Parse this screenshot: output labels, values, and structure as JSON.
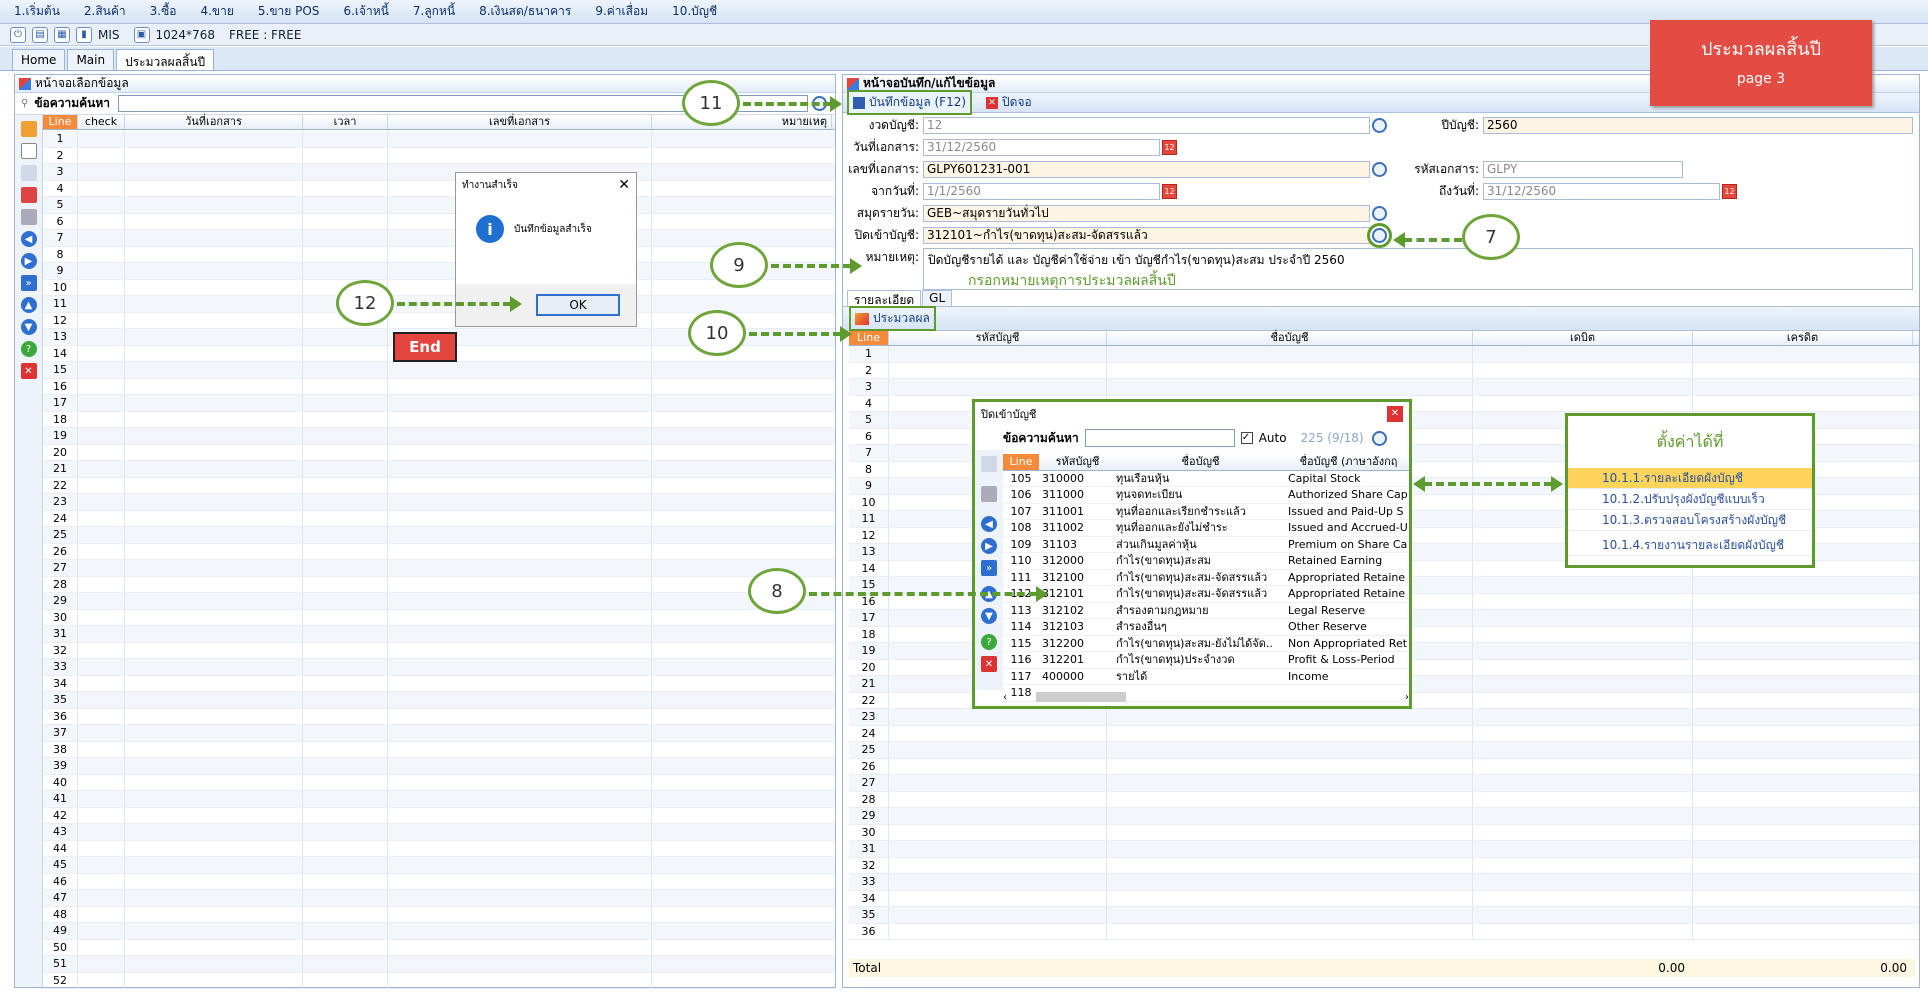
{
  "menu": [
    "1.เริ่มต้น",
    "2.สินค้า",
    "3.ซื้อ",
    "4.ขาย",
    "5.ขาย POS",
    "6.เจ้าหนี้",
    "7.ลูกหนี้",
    "8.เงินสด/ธนาคาร",
    "9.ค่าเสื่อม",
    "10.บัญชี"
  ],
  "toolbar": {
    "mis": "MIS",
    "resolution": "1024*768",
    "free": "FREE : FREE"
  },
  "tabs": [
    "Home",
    "Main",
    "ประมวลผลสิ้นปี"
  ],
  "left_panel": {
    "title": "หน้าจอเลือกข้อมูล",
    "search_label": "ข้อความค้นหา",
    "columns": [
      "Line",
      "check",
      "วันที่เอกสาร",
      "เวลา",
      "เลขที่เอกสาร",
      "หมายเหตุ"
    ],
    "rows": [
      1,
      2,
      3,
      4,
      5,
      6,
      7,
      8,
      9,
      10,
      11,
      12,
      13,
      14,
      15,
      16,
      17,
      18,
      19,
      20,
      21,
      22,
      23,
      24,
      25,
      26,
      27,
      28,
      29,
      30,
      31,
      32,
      33,
      34,
      35,
      36,
      37,
      38,
      39,
      40,
      41,
      42,
      43,
      44,
      45,
      46,
      47,
      48,
      49,
      50,
      51,
      52
    ]
  },
  "right_panel": {
    "title": "หน้าจอบันทึก/แก้ไขข้อมูล",
    "save_btn": "บันทึกข้อมูล (F12)",
    "close_btn": "ปิดจอ",
    "fields": {
      "period_label": "งวดบัญชี:",
      "period_value": "12",
      "year_label": "ปีบัญชี:",
      "year_value": "2560",
      "docdate_label": "วันที่เอกสาร:",
      "docdate_value": "31/12/2560",
      "docno_label": "เลขที่เอกสาร:",
      "docno_value": "GLPY601231-001",
      "doccode_label": "รหัสเอกสาร:",
      "doccode_value": "GLPY",
      "from_label": "จากวันที่:",
      "from_value": "1/1/2560",
      "to_label": "ถึงวันที่:",
      "to_value": "31/12/2560",
      "journal_label": "สมุดรายวัน:",
      "journal_value": "GEB~สมุดรายวันทั่วไป",
      "closeacct_label": "ปิดเข้าบัญชี:",
      "closeacct_value": "312101~กำไร(ขาดทุน)สะสม-จัดสรรแล้ว",
      "remark_label": "หมายเหตุ:",
      "remark_value": "ปิดบัญชีรายได้ และ บัญชีค่าใช้จ่าย เข้า บัญชีกำไร(ขาดทุน)สะสม ประจำปี 2560",
      "remark_hint": "กรอกหมายเหตุการประมวลผลสิ้นปี"
    },
    "subtabs": [
      "รายละเอียด",
      "GL"
    ],
    "process_btn": "ประมวลผล",
    "columns": [
      "Line",
      "รหัสบัญชี",
      "ชื่อบัญชี",
      "เดบิต",
      "เครดิต"
    ],
    "rows": [
      1,
      2,
      3,
      4,
      5,
      6,
      7,
      8,
      9,
      10,
      11,
      12,
      13,
      14,
      15,
      16,
      17,
      18,
      19,
      20,
      21,
      22,
      23,
      24,
      25,
      26,
      27,
      28,
      29,
      30,
      31,
      32,
      33,
      34,
      35,
      36
    ],
    "total_label": "Total",
    "total_debit": "0.00",
    "total_credit": "0.00"
  },
  "banner": {
    "title": "ประมวลผลสิ้นปี",
    "page": "page 3"
  },
  "dialog": {
    "title": "ทำงานสำเร็จ",
    "message": "บันทึกข้อมูลสำเร็จ",
    "ok": "OK"
  },
  "end_label": "End",
  "popup": {
    "title": "ปิดเข้าบัญชี",
    "search_label": "ข้อความค้นหา",
    "auto_label": "Auto",
    "count": "225 (9/18)",
    "columns": [
      "Line",
      "รหัสบัญชี",
      "ชื่อบัญชี",
      "ชื่อบัญชี (ภาษาอังกฤ"
    ],
    "rows": [
      [
        "105",
        "310000",
        "ทุนเรือนหุ้น",
        "Capital Stock"
      ],
      [
        "106",
        "311000",
        "ทุนจดทะเบียน",
        "Authorized Share Cap"
      ],
      [
        "107",
        "311001",
        "ทุนที่ออกและเรียกชำระแล้ว",
        "Issued and Paid-Up S"
      ],
      [
        "108",
        "311002",
        "ทุนที่ออกและยังไม่ชำระ",
        "Issued and Accrued-U"
      ],
      [
        "109",
        "31103",
        "ส่วนเกินมูลค่าหุ้น",
        "Premium on Share Ca"
      ],
      [
        "110",
        "312000",
        "กำไร(ขาดทุน)สะสม",
        "Retained Earning"
      ],
      [
        "111",
        "312100",
        "กำไร(ขาดทุน)สะสม-จัดสรรแล้ว",
        "Appropriated Retaine"
      ],
      [
        "112",
        "312101",
        "กำไร(ขาดทุน)สะสม-จัดสรรแล้ว",
        "Appropriated Retaine"
      ],
      [
        "113",
        "312102",
        "สำรองตามกฎหมาย",
        "Legal Reserve"
      ],
      [
        "114",
        "312103",
        "สำรองอื่นๆ",
        "Other Reserve"
      ],
      [
        "115",
        "312200",
        "กำไร(ขาดทุน)สะสม-ยังไม่ได้จัด..",
        "Non Appropriated Ret"
      ],
      [
        "116",
        "312201",
        "กำไร(ขาดทุน)ประจำงวด",
        "Profit & Loss-Period"
      ],
      [
        "117",
        "400000",
        "รายได้",
        "Income"
      ],
      [
        "118",
        "",
        "",
        ""
      ]
    ]
  },
  "config": {
    "title": "ตั้งค่าได้ที่",
    "items": [
      "10.1.1.รายละเอียดผังบัญชี",
      "10.1.2.ปรับปรุงผังบัญชีแบบเร็ว",
      "10.1.3.ตรวจสอบโครงสร้างผังบัญชี",
      "10.1.4.รายงานรายละเอียดผังบัญชี"
    ]
  },
  "callouts": [
    "7",
    "8",
    "9",
    "10",
    "11",
    "12"
  ],
  "colors": {
    "accent_green": "#5e9b2e",
    "banner_red": "#e24c43",
    "line_header": "#f58a3a"
  }
}
